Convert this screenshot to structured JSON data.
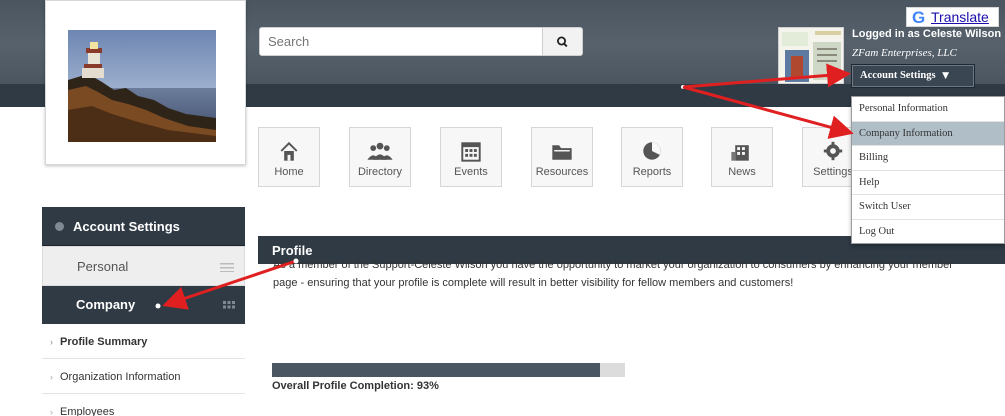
{
  "colors": {
    "header": "#4e5964",
    "dark_panel": "#2f3a45",
    "active_item": "#b0bec8",
    "annotation_red": "#e02020",
    "link_blue": "#1a0dab",
    "google_blue": "#4285f4"
  },
  "header": {
    "search": {
      "placeholder": "Search",
      "icon": "search-icon"
    },
    "translate": {
      "g": "G",
      "label": "Translate"
    },
    "user": {
      "logged_in": "Logged in as Celeste Wilson",
      "company": "ZFam Enterprises, LLC",
      "account_button": "Account Settings",
      "caret": "▼"
    }
  },
  "dropdown": {
    "items": [
      {
        "label": "Personal Information"
      },
      {
        "label": "Company Information",
        "active": true
      },
      {
        "label": "Billing"
      },
      {
        "label": "Help"
      },
      {
        "label": "Switch User"
      },
      {
        "label": "Log Out"
      }
    ]
  },
  "nav": {
    "tiles": [
      {
        "label": "Home",
        "icon": "home-icon"
      },
      {
        "label": "Directory",
        "icon": "people-icon"
      },
      {
        "label": "Events",
        "icon": "calendar-icon"
      },
      {
        "label": "Resources",
        "icon": "folder-icon"
      },
      {
        "label": "Reports",
        "icon": "pie-chart-icon"
      },
      {
        "label": "News",
        "icon": "building-icon"
      },
      {
        "label": "Settings",
        "icon": "gear-icon"
      }
    ]
  },
  "sidebar": {
    "title": "Account Settings",
    "personal": "Personal",
    "company": "Company",
    "sub_items": [
      {
        "label": "Profile Summary",
        "bold": true
      },
      {
        "label": "Organization Information"
      },
      {
        "label": "Employees"
      }
    ]
  },
  "main": {
    "section_title": "Profile",
    "intro": "As a member of the Support-Celeste Wilson you have the opportunity to market your organization to consumers by enhancing your member page - ensuring that your profile is complete will result in better visibility for fellow members and customers!",
    "completion_label": "Overall Profile Completion: 93%",
    "completion_value": 0.93
  }
}
